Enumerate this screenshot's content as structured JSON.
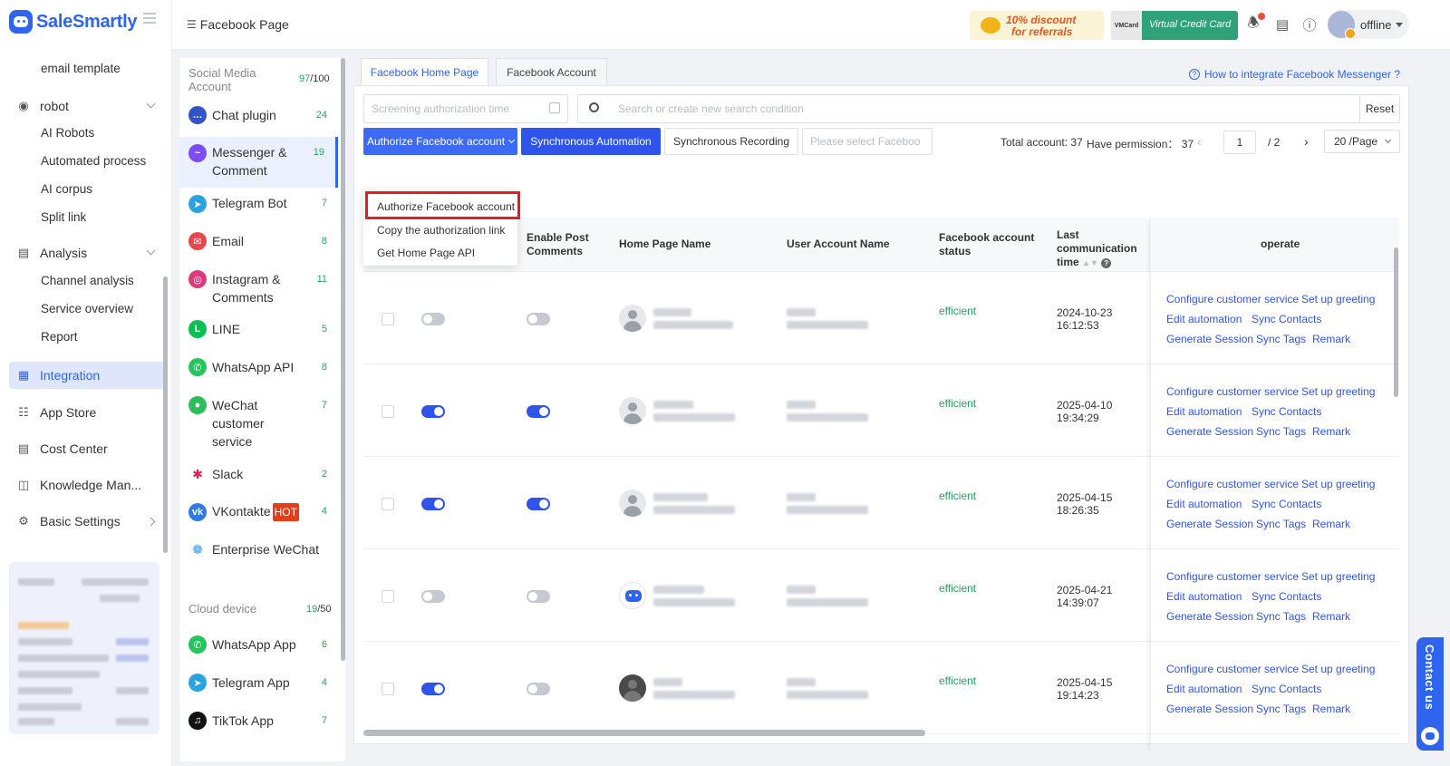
{
  "app": {
    "logo_text": "SaleSmartly",
    "breadcrumb": "Facebook Page"
  },
  "topbar": {
    "referral_banner_line1": "10% discount",
    "referral_banner_line2": "for referrals",
    "vcc_tag": "VMCard",
    "vcc_banner": "Virtual Credit Card",
    "user_status": "offline"
  },
  "leftnav": {
    "email_template": "email template",
    "robot": "robot",
    "robot_children": [
      "AI Robots",
      "Automated process",
      "AI corpus",
      "Split link"
    ],
    "analysis": "Analysis",
    "analysis_children": [
      "Channel analysis",
      "Service overview",
      "Report"
    ],
    "integration": "Integration",
    "app_store": "App Store",
    "cost_center": "Cost Center",
    "knowledge": "Knowledge Man...",
    "basic_settings": "Basic Settings"
  },
  "channels": {
    "social_title": "Social Media Account",
    "social_used": "97",
    "social_total": "/100",
    "items": [
      {
        "label": "Chat plugin",
        "count": "24"
      },
      {
        "label": "Messenger & Comment",
        "count": "19"
      },
      {
        "label": "Telegram Bot",
        "count": "7"
      },
      {
        "label": "Email",
        "count": "8"
      },
      {
        "label": "Instagram & Comments",
        "count": "11"
      },
      {
        "label": "LINE",
        "count": "5"
      },
      {
        "label": "WhatsApp API",
        "count": "8"
      },
      {
        "label": "WeChat customer service",
        "count": "7"
      },
      {
        "label": "Slack",
        "count": "2"
      },
      {
        "label": "VKontakte",
        "badge": "HOT",
        "count": "4"
      },
      {
        "label": "Enterprise WeChat",
        "count": ""
      }
    ],
    "cloud_title": "Cloud device",
    "cloud_used": "19",
    "cloud_total": "/50",
    "cloud_items": [
      {
        "label": "WhatsApp App",
        "count": "6"
      },
      {
        "label": "Telegram App",
        "count": "4"
      },
      {
        "label": "TikTok App",
        "count": "7"
      }
    ]
  },
  "main": {
    "tabs": [
      "Facebook Home Page",
      "Facebook Account"
    ],
    "help_link": "How to integrate Facebook Messenger ?",
    "date_placeholder": "Screening authorization time",
    "search_placeholder": "Search or create new search condition",
    "reset": "Reset",
    "authorize_button": "Authorize Facebook account",
    "sync_automation": "Synchronous Automation",
    "sync_recording": "Synchronous Recording",
    "select_placeholder": "Please select Faceboo",
    "total_account": "Total account: 37",
    "have_permission": "Have permission： 37",
    "page_current": "1",
    "page_total": "/  2",
    "page_size": "20 /Page",
    "dropdown": [
      "Authorize Facebook account",
      "Copy the authorization link",
      "Get Home Page API"
    ]
  },
  "table": {
    "headers": {
      "enable_post": "Enable Post Comments",
      "home_page_name": "Home Page Name",
      "user_account_name": "User Account Name",
      "fb_status": "Facebook account status",
      "last_comm": "Last communication time",
      "operate": "operate"
    },
    "rows": [
      {
        "date": "2024-10-23",
        "time": "16:12:53",
        "status": "efficient",
        "messenger_on": false,
        "post_on": false
      },
      {
        "date": "2025-04-10",
        "time": "19:34:29",
        "status": "efficient",
        "messenger_on": true,
        "post_on": true
      },
      {
        "date": "2025-04-15",
        "time": "18:26:35",
        "status": "efficient",
        "messenger_on": true,
        "post_on": true
      },
      {
        "date": "2025-04-21",
        "time": "14:39:07",
        "status": "efficient",
        "messenger_on": false,
        "post_on": false
      },
      {
        "date": "2025-04-15",
        "time": "19:14:23",
        "status": "efficient",
        "messenger_on": true,
        "post_on": false
      }
    ],
    "ops": {
      "configure": "Configure customer service",
      "greeting": "Set up greeting",
      "edit_auto": "Edit automation",
      "sync_contacts": "Sync Contacts",
      "gen_session": "Generate Session",
      "sync_tags": "Sync Tags",
      "remark": "Remark"
    }
  },
  "contact_us": "Contact us",
  "colors": {
    "brand": "#2f64f0",
    "primary_button": "#2f54eb",
    "status_green": "#23a55a",
    "highlight_red": "#e02020"
  }
}
